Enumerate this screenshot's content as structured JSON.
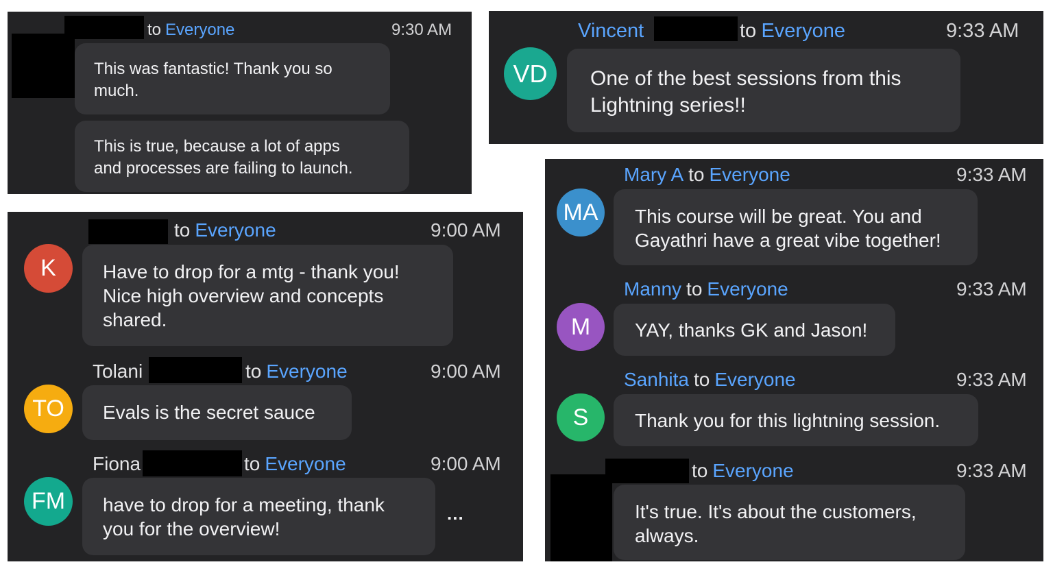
{
  "panel_a": {
    "messages": [
      {
        "sender": "",
        "to": "to",
        "recipient": "Everyone",
        "time": "9:30 AM",
        "bubbles": [
          "This was fantastic! Thank you so\nmuch.",
          "This is true, because a lot of apps\nand processes are failing to launch."
        ]
      }
    ]
  },
  "panel_b": {
    "messages": [
      {
        "sender": "Vincent",
        "to": "to",
        "recipient": "Everyone",
        "time": "9:33 AM",
        "avatar": "VD",
        "avatar_color": "#1aa890",
        "text": "One of the best sessions from this\nLightning series!!"
      }
    ]
  },
  "panel_c": {
    "messages": [
      {
        "sender": "",
        "to": "to",
        "recipient": "Everyone",
        "time": "9:00 AM",
        "avatar": "K",
        "avatar_color": "#d54b37",
        "text": "Have to drop for a mtg - thank you!\nNice high overview and concepts\nshared."
      },
      {
        "sender": "Tolani",
        "to": "to",
        "recipient": "Everyone",
        "time": "9:00 AM",
        "avatar": "TO",
        "avatar_color": "#f6ac10",
        "text": "Evals is the secret sauce"
      },
      {
        "sender": "Fiona",
        "to": "to",
        "recipient": "Everyone",
        "time": "9:00 AM",
        "avatar": "FM",
        "avatar_color": "#13a98e",
        "text": "have to drop for a meeting, thank\nyou for the overview!"
      }
    ],
    "more": "..."
  },
  "panel_d": {
    "messages": [
      {
        "sender": "Mary A",
        "to": "to",
        "recipient": "Everyone",
        "time": "9:33 AM",
        "avatar": "MA",
        "avatar_color": "#3b90cc",
        "text": "This course will be great. You and\nGayathri have a great vibe together!"
      },
      {
        "sender": "Manny",
        "to": "to",
        "recipient": "Everyone",
        "time": "9:33 AM",
        "avatar": "M",
        "avatar_color": "#9855c1",
        "text": "YAY, thanks GK and Jason!"
      },
      {
        "sender": "Sanhita",
        "to": "to",
        "recipient": "Everyone",
        "time": "9:33 AM",
        "avatar": "S",
        "avatar_color": "#27b66a",
        "text": "Thank you for this lightning session."
      },
      {
        "sender": "",
        "to": "to",
        "recipient": "Everyone",
        "time": "9:33 AM",
        "text": "It's true. It's about the customers,\nalways."
      }
    ]
  }
}
